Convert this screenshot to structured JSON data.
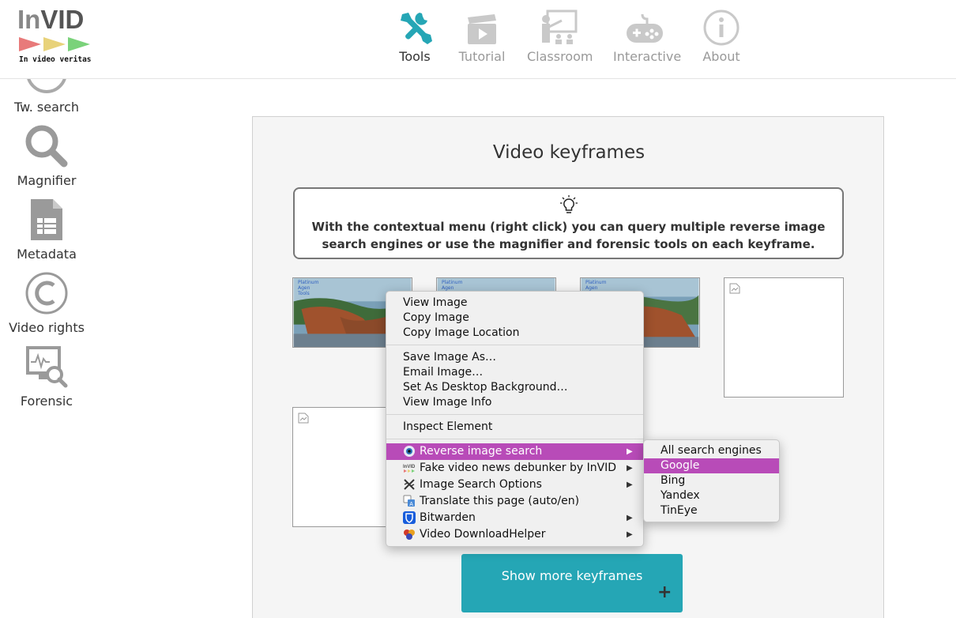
{
  "logo": {
    "word_in": "In",
    "word_vid": "VID",
    "motto": "In video veritas"
  },
  "nav": {
    "items": [
      {
        "label": "Tools",
        "icon": "tools-icon",
        "active": true
      },
      {
        "label": "Tutorial",
        "icon": "clapperboard-icon"
      },
      {
        "label": "Classroom",
        "icon": "classroom-icon"
      },
      {
        "label": "Interactive",
        "icon": "gamepad-icon"
      },
      {
        "label": "About",
        "icon": "info-icon"
      }
    ]
  },
  "sidebar": {
    "items": [
      {
        "label": "Tw. search",
        "icon": "twitter-search-icon"
      },
      {
        "label": "Magnifier",
        "icon": "magnifier-icon"
      },
      {
        "label": "Metadata",
        "icon": "metadata-file-icon"
      },
      {
        "label": "Video rights",
        "icon": "copyright-icon"
      },
      {
        "label": "Forensic",
        "icon": "forensic-icon"
      }
    ]
  },
  "main": {
    "title": "Video keyframes",
    "tip": "With the contextual menu (right click) you can query multiple reverse image search engines or use the magnifier and forensic tools on each keyframe.",
    "keyframe_caption": "Platinum\nAgen\nTools",
    "show_more_label": "Show more keyframes",
    "show_more_plus": "+"
  },
  "context_menu": {
    "items": [
      {
        "label": "View Image"
      },
      {
        "label": "Copy Image"
      },
      {
        "label": "Copy Image Location"
      },
      {
        "label": "Save Image As…"
      },
      {
        "label": "Email Image…"
      },
      {
        "label": "Set As Desktop Background…"
      },
      {
        "label": "View Image Info"
      },
      {
        "label": "Inspect Element"
      },
      {
        "label": "Reverse image search",
        "icon": "eye-icon",
        "submenu": true,
        "highlighted": true
      },
      {
        "label": "Fake video news debunker by InVID",
        "icon": "invid-icon",
        "submenu": true
      },
      {
        "label": "Image Search Options",
        "icon": "image-search-options-icon",
        "submenu": true
      },
      {
        "label": "Translate this page (auto/en)",
        "icon": "translate-icon"
      },
      {
        "label": "Bitwarden",
        "icon": "bitwarden-shield-icon",
        "submenu": true
      },
      {
        "label": "Video DownloadHelper",
        "icon": "downloadhelper-balls-icon",
        "submenu": true
      }
    ],
    "submenu_arrow": "▶"
  },
  "reverse_search_submenu": {
    "items": [
      {
        "label": "All search engines"
      },
      {
        "label": "Google",
        "highlighted": true
      },
      {
        "label": "Bing"
      },
      {
        "label": "Yandex"
      },
      {
        "label": "TinEye"
      }
    ]
  },
  "colors": {
    "accent": "#25a6b5",
    "highlight": "#b84bb8",
    "nav_active": "#25a6b5",
    "logo_red": "#e87a7a",
    "logo_yellow": "#e8d27a",
    "logo_green": "#7ad27a"
  }
}
